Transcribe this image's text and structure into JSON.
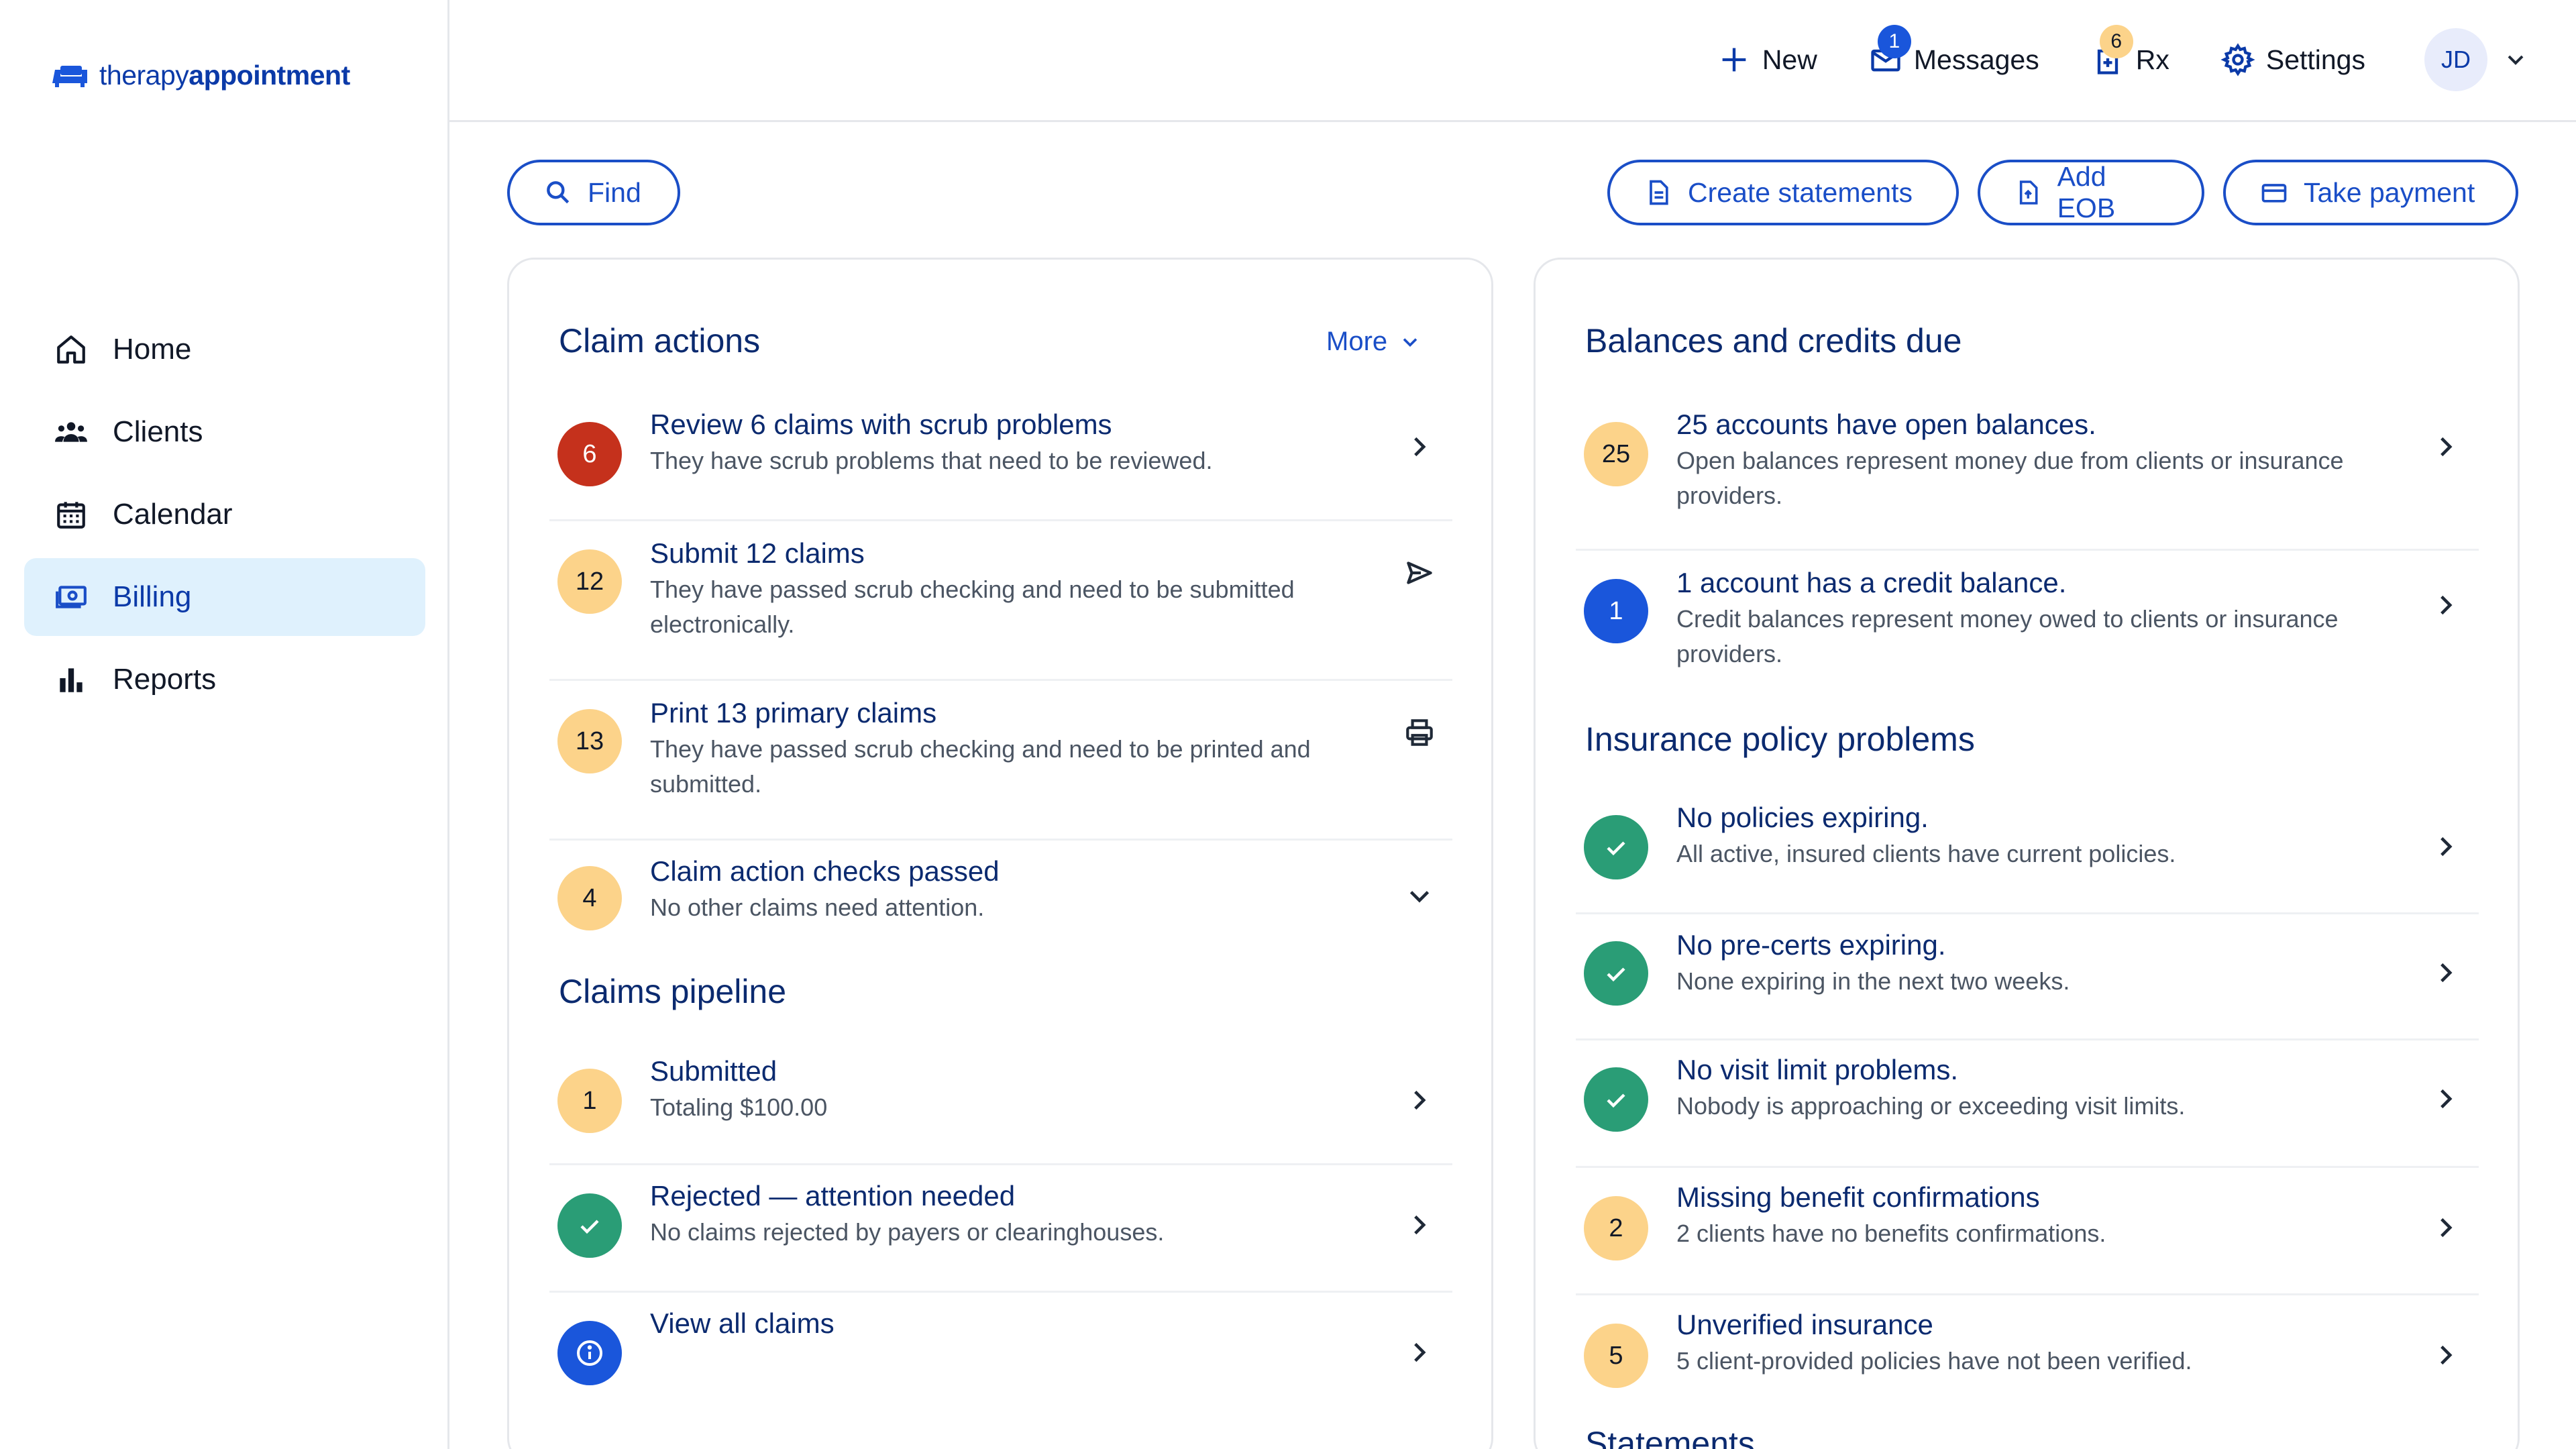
{
  "app": {
    "logo_light": "therapy",
    "logo_bold": "appointment"
  },
  "sidebar": {
    "items": [
      {
        "label": "Home",
        "icon": "home-icon",
        "active": false
      },
      {
        "label": "Clients",
        "icon": "clients-icon",
        "active": false
      },
      {
        "label": "Calendar",
        "icon": "calendar-icon",
        "active": false
      },
      {
        "label": "Billing",
        "icon": "billing-icon",
        "active": true
      },
      {
        "label": "Reports",
        "icon": "reports-icon",
        "active": false
      }
    ]
  },
  "topbar": {
    "new_label": "New",
    "messages_label": "Messages",
    "messages_badge": "1",
    "rx_label": "Rx",
    "rx_badge": "6",
    "settings_label": "Settings",
    "avatar_initials": "JD"
  },
  "actions": {
    "find": "Find",
    "create_statements": "Create statements",
    "add_eob": "Add EOB",
    "take_payment": "Take payment"
  },
  "claim_actions": {
    "title": "Claim actions",
    "more": "More",
    "rows": [
      {
        "count": "6",
        "color": "red",
        "title": "Review 6 claims with scrub problems",
        "sub": "They have scrub problems that need to be reviewed.",
        "trail": "chevron-right-icon"
      },
      {
        "count": "12",
        "color": "yellow",
        "title": "Submit 12 claims",
        "sub": "They have passed scrub checking and need to be submitted electronically.",
        "trail": "send-icon"
      },
      {
        "count": "13",
        "color": "yellow",
        "title": "Print 13 primary claims",
        "sub": "They have passed scrub checking and need to be printed and submitted.",
        "trail": "printer-icon"
      },
      {
        "count": "4",
        "color": "yellow",
        "title": "Claim action checks passed",
        "sub": "No other claims need attention.",
        "trail": "chevron-down-icon"
      }
    ]
  },
  "claims_pipeline": {
    "title": "Claims pipeline",
    "rows": [
      {
        "count": "1",
        "color": "yellow",
        "title": "Submitted",
        "sub": "Totaling $100.00"
      },
      {
        "icon": "check-icon",
        "color": "green",
        "title": "Rejected — attention needed",
        "sub": "No claims rejected by payers or clearinghouses."
      },
      {
        "icon": "info-icon",
        "color": "blue",
        "title": "View all claims",
        "sub": ""
      }
    ]
  },
  "balances": {
    "title": "Balances and credits due",
    "rows": [
      {
        "count": "25",
        "color": "yellow",
        "title": "25 accounts have open balances.",
        "sub": "Open balances represent money due from clients or insurance providers."
      },
      {
        "count": "1",
        "color": "blue",
        "title": "1 account has a credit balance.",
        "sub": "Credit balances represent money owed to clients or insurance providers."
      }
    ]
  },
  "insurance": {
    "title": "Insurance policy problems",
    "rows": [
      {
        "icon": "check-icon",
        "color": "green",
        "title": "No policies expiring.",
        "sub": "All active, insured clients have current policies."
      },
      {
        "icon": "check-icon",
        "color": "green",
        "title": "No pre-certs expiring.",
        "sub": "None expiring in the next two weeks."
      },
      {
        "icon": "check-icon",
        "color": "green",
        "title": "No visit limit problems.",
        "sub": "Nobody is approaching or exceeding visit limits."
      },
      {
        "count": "2",
        "color": "yellow",
        "title": "Missing benefit confirmations",
        "sub": "2 clients have no benefits confirmations."
      },
      {
        "count": "5",
        "color": "yellow",
        "title": "Unverified insurance",
        "sub": "5 client-provided policies have not been verified."
      }
    ]
  },
  "statements": {
    "title": "Statements"
  }
}
